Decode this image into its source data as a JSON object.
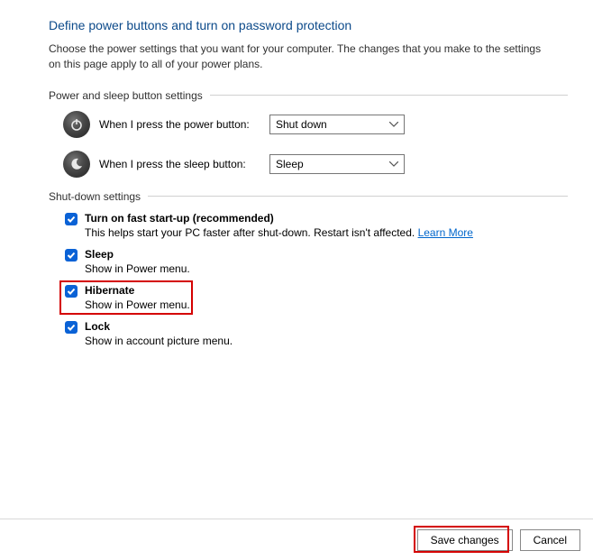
{
  "title": "Define power buttons and turn on password protection",
  "description": "Choose the power settings that you want for your computer. The changes that you make to the settings on this page apply to all of your power plans.",
  "sections": {
    "buttons": {
      "header": "Power and sleep button settings",
      "power": {
        "label": "When I press the power button:",
        "value": "Shut down"
      },
      "sleep": {
        "label": "When I press the sleep button:",
        "value": "Sleep"
      }
    },
    "shutdown": {
      "header": "Shut-down settings",
      "items": {
        "fast_startup": {
          "label": "Turn on fast start-up (recommended)",
          "sub": "This helps start your PC faster after shut-down. Restart isn't affected. ",
          "link": "Learn More",
          "checked": true
        },
        "sleep": {
          "label": "Sleep",
          "sub": "Show in Power menu.",
          "checked": true
        },
        "hibernate": {
          "label": "Hibernate",
          "sub": "Show in Power menu.",
          "checked": true
        },
        "lock": {
          "label": "Lock",
          "sub": "Show in account picture menu.",
          "checked": true
        }
      }
    }
  },
  "footer": {
    "save": "Save changes",
    "cancel": "Cancel"
  }
}
